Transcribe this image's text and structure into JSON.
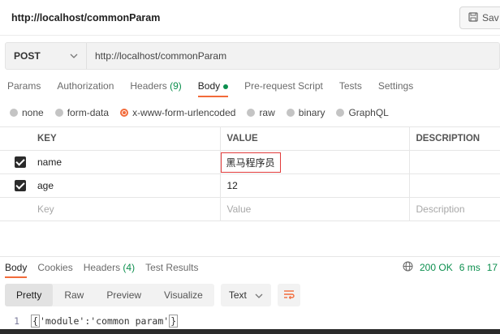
{
  "titlebar": {
    "title": "http://localhost/commonParam",
    "save_label": "Sav"
  },
  "request": {
    "method": "POST",
    "url": "http://localhost/commonParam"
  },
  "req_tabs": [
    {
      "label": "Params"
    },
    {
      "label": "Authorization"
    },
    {
      "label": "Headers",
      "count": "(9)"
    },
    {
      "label": "Body",
      "active": true
    },
    {
      "label": "Pre-request Script"
    },
    {
      "label": "Tests"
    },
    {
      "label": "Settings"
    }
  ],
  "body_types": [
    "none",
    "form-data",
    "x-www-form-urlencoded",
    "raw",
    "binary",
    "GraphQL"
  ],
  "body_type_selected": "x-www-form-urlencoded",
  "table": {
    "headers": {
      "key": "KEY",
      "value": "VALUE",
      "description": "DESCRIPTION"
    },
    "rows": [
      {
        "checked": true,
        "key": "name",
        "value": "黑马程序员"
      },
      {
        "checked": true,
        "key": "age",
        "value": "12"
      }
    ],
    "placeholder": {
      "key": "Key",
      "value": "Value",
      "description": "Description"
    }
  },
  "resp_tabs": [
    {
      "label": "Body",
      "active": true
    },
    {
      "label": "Cookies"
    },
    {
      "label": "Headers",
      "count": "(4)"
    },
    {
      "label": "Test Results"
    }
  ],
  "resp_meta": {
    "status": "200 OK",
    "time": "6 ms",
    "size": "17"
  },
  "resp_tools": {
    "views": [
      "Pretty",
      "Raw",
      "Preview",
      "Visualize"
    ],
    "format": "Text"
  },
  "code": {
    "line": "1",
    "text": "'module':'common param'",
    "open": "{",
    "close": "}"
  },
  "colors": {
    "accent": "#f26b3a",
    "success": "#0c8f4e",
    "highlight": "#e23b3b"
  }
}
